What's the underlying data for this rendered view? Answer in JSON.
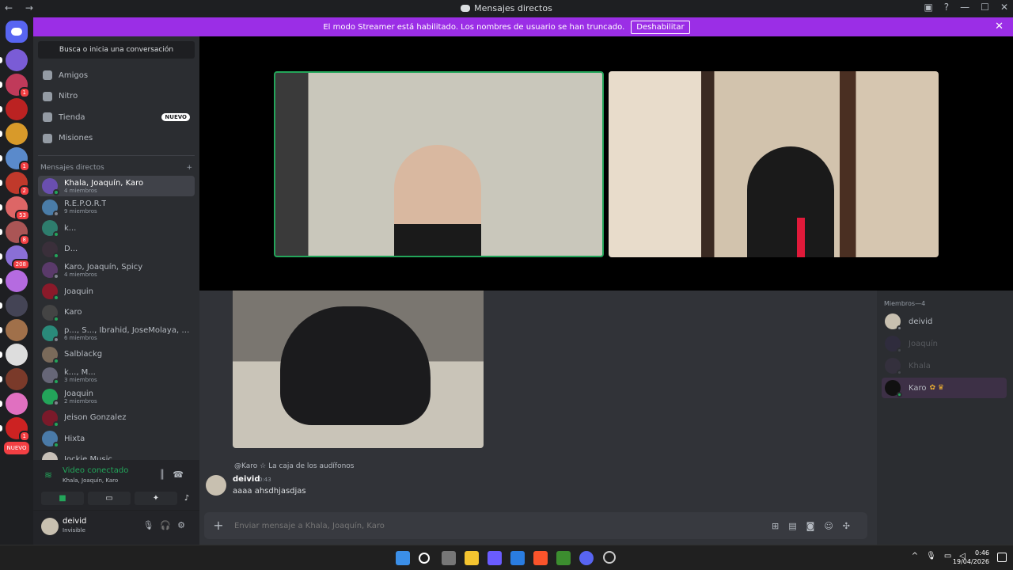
{
  "window": {
    "title": "Mensajes directos"
  },
  "banner": {
    "text": "El modo Streamer está habilitado. Los nombres de usuario se han truncado.",
    "button": "Deshabilitar"
  },
  "servers": [
    {
      "badge": ""
    },
    {
      "badge": "1"
    },
    {
      "badge": ""
    },
    {
      "badge": ""
    },
    {
      "badge": "1"
    },
    {
      "badge": "2"
    },
    {
      "badge": "53"
    },
    {
      "badge": "8"
    },
    {
      "badge": "208"
    },
    {
      "badge": ""
    },
    {
      "badge": ""
    },
    {
      "badge": ""
    },
    {
      "badge": ""
    },
    {
      "badge": ""
    },
    {
      "badge": ""
    },
    {
      "badge": "1"
    }
  ],
  "servers_new": "NUEVO",
  "search": {
    "label": "Busca o inicia una conversación"
  },
  "nav": [
    {
      "label": "Amigos"
    },
    {
      "label": "Nitro"
    },
    {
      "label": "Tienda",
      "tag": "NUEVO"
    },
    {
      "label": "Misiones"
    }
  ],
  "dm_header": "Mensajes directos",
  "dms": [
    {
      "name": "Khala, Joaquín, Karo",
      "sub": "4 miembros",
      "selected": true
    },
    {
      "name": "R.E.P.O.R.T",
      "sub": "9 miembros"
    },
    {
      "name": "k...",
      "sub": ""
    },
    {
      "name": "D...",
      "sub": ""
    },
    {
      "name": "Karo, Joaquín, Spicy",
      "sub": "4 miembros"
    },
    {
      "name": "Joaquin",
      "sub": ""
    },
    {
      "name": "Karo",
      "sub": ""
    },
    {
      "name": "p..., S..., Ibrahid, JoseMolaya, Jud...",
      "sub": "6 miembros"
    },
    {
      "name": "Salblackg",
      "sub": ""
    },
    {
      "name": "k..., M...",
      "sub": "3 miembros"
    },
    {
      "name": "Joaquin",
      "sub": "2 miembros"
    },
    {
      "name": "Jeison Gonzalez",
      "sub": ""
    },
    {
      "name": "Hixta",
      "sub": ""
    },
    {
      "name": "Jockie Music",
      "sub": ""
    }
  ],
  "voice": {
    "status": "Video conectado",
    "channel": "Khala, Joaquín, Karo"
  },
  "user": {
    "name": "deivid",
    "status": "Invisible"
  },
  "chat": {
    "reply": {
      "mention": "@Karo",
      "text": "La caja de los audífonos"
    },
    "message": {
      "author": "deivid",
      "time": "0:43",
      "text": "aaaa ahsdhjasdjas"
    },
    "placeholder": "Enviar mensaje a Khala, Joaquín, Karo"
  },
  "members": {
    "header": "Miembros—4",
    "list": [
      {
        "name": "deivid",
        "online": false
      },
      {
        "name": "Joaquín",
        "online": false
      },
      {
        "name": "Khala",
        "online": false
      },
      {
        "name": "Karo",
        "online": true
      }
    ]
  },
  "clock": {
    "time": "0:46",
    "date": "19/04/2026"
  },
  "colors": {
    "accent": "#5865f2",
    "banner": "#9b2ee6",
    "online": "#23a55a",
    "danger": "#f23f43"
  }
}
